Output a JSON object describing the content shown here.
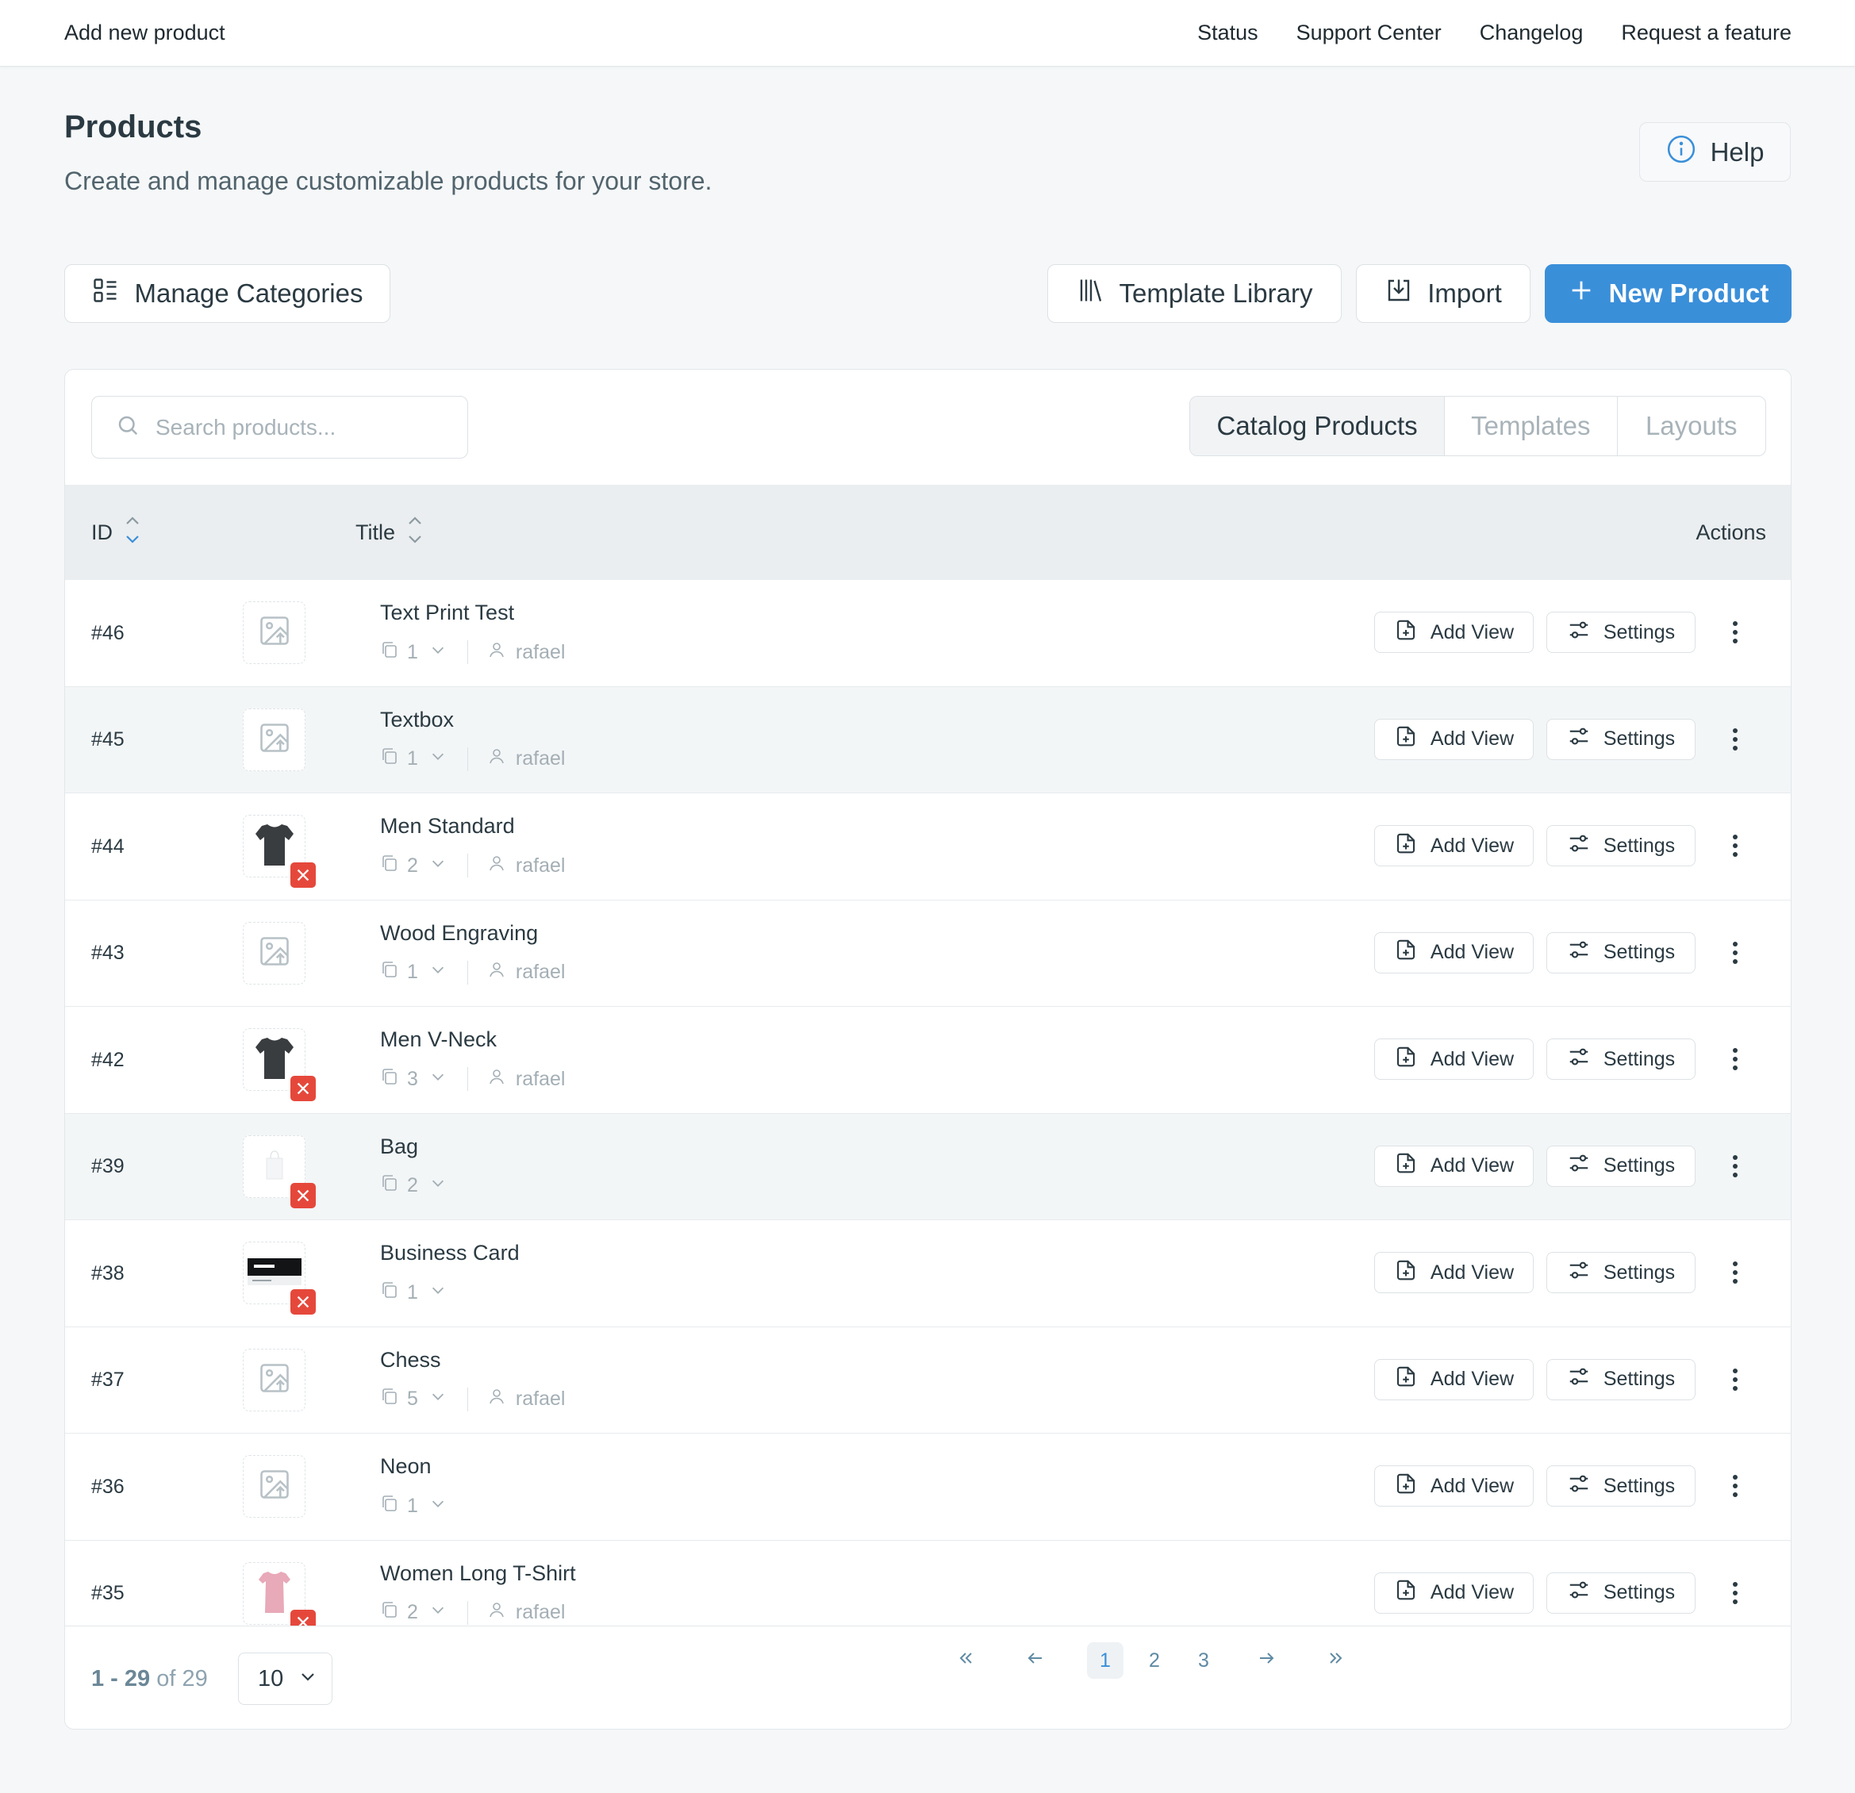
{
  "topbar": {
    "title": "Add new product",
    "links": [
      "Status",
      "Support Center",
      "Changelog",
      "Request a feature"
    ]
  },
  "header": {
    "title": "Products",
    "subtitle": "Create and manage customizable products for your store.",
    "help_label": "Help"
  },
  "toolbar": {
    "manage_categories": "Manage Categories",
    "template_library": "Template Library",
    "import": "Import",
    "new_product": "New Product"
  },
  "search": {
    "placeholder": "Search products...",
    "value": ""
  },
  "tabs": [
    {
      "label": "Catalog Products",
      "active": true
    },
    {
      "label": "Templates",
      "active": false
    },
    {
      "label": "Layouts",
      "active": false
    }
  ],
  "table": {
    "columns": {
      "id": "ID",
      "title": "Title",
      "actions": "Actions"
    },
    "action_labels": {
      "add_view": "Add View",
      "settings": "Settings"
    },
    "rows": [
      {
        "id": "#46",
        "title": "Text Print Test",
        "views": "1",
        "author": "rafael",
        "thumb": "placeholder-image-icon",
        "error": false
      },
      {
        "id": "#45",
        "title": "Textbox",
        "views": "1",
        "author": "rafael",
        "thumb": "placeholder-image-icon",
        "error": false
      },
      {
        "id": "#44",
        "title": "Men Standard",
        "views": "2",
        "author": "rafael",
        "thumb": "tshirt-dark",
        "error": true
      },
      {
        "id": "#43",
        "title": "Wood Engraving",
        "views": "1",
        "author": "rafael",
        "thumb": "placeholder-image-icon",
        "error": false
      },
      {
        "id": "#42",
        "title": "Men V-Neck",
        "views": "3",
        "author": "rafael",
        "thumb": "tshirt-dark",
        "error": true
      },
      {
        "id": "#39",
        "title": "Bag",
        "views": "2",
        "author": "",
        "thumb": "bag-white",
        "error": true
      },
      {
        "id": "#38",
        "title": "Business Card",
        "views": "1",
        "author": "",
        "thumb": "business-card",
        "error": true
      },
      {
        "id": "#37",
        "title": "Chess",
        "views": "5",
        "author": "rafael",
        "thumb": "placeholder-image-icon",
        "error": false
      },
      {
        "id": "#36",
        "title": "Neon",
        "views": "1",
        "author": "",
        "thumb": "placeholder-image-icon",
        "error": false
      },
      {
        "id": "#35",
        "title": "Women Long T-Shirt",
        "views": "2",
        "author": "rafael",
        "thumb": "tshirt-pink",
        "error": true
      }
    ]
  },
  "pagination": {
    "range": "1 - 29",
    "of_label": "of",
    "total": "29",
    "per_page": "10",
    "pages": [
      "1",
      "2",
      "3"
    ],
    "current_page": "1"
  },
  "colors": {
    "accent": "#3a8fd9",
    "error": "#e5483b",
    "row_alt": "#f3f6f7",
    "header_bg": "#ebeef0"
  }
}
